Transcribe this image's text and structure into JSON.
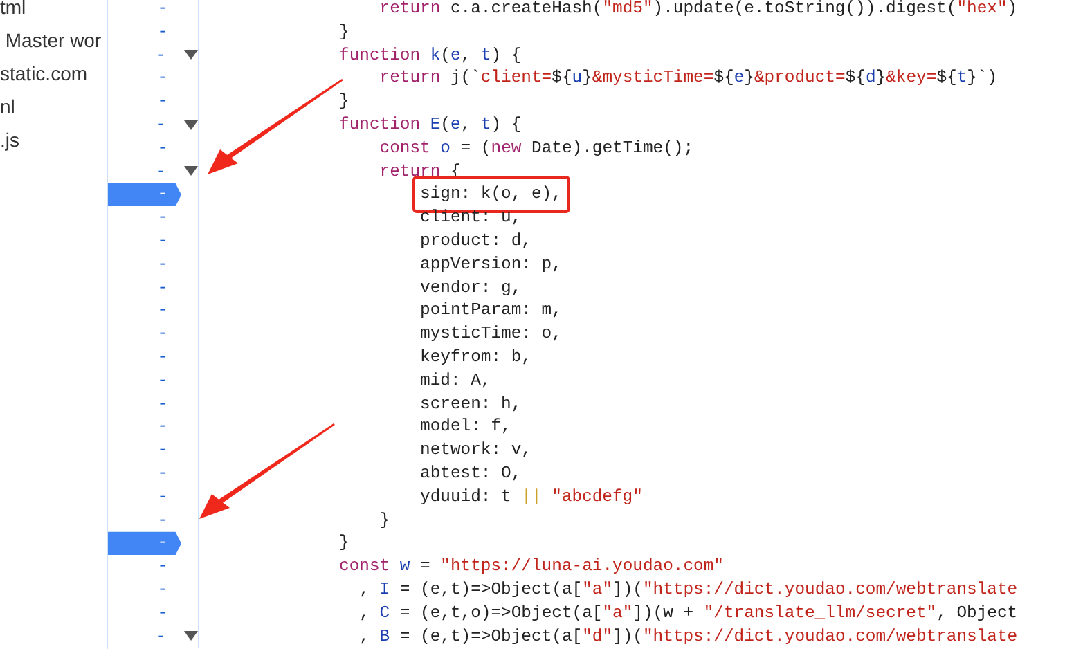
{
  "sidebar": {
    "items": [
      {
        "label": "tml"
      },
      {
        "label": " Master wor"
      },
      {
        "label": "static.com"
      },
      {
        "label": "nl"
      },
      {
        "label": ".js"
      }
    ]
  },
  "editor": {
    "lines": [
      {
        "number": "-",
        "breakpoint": false,
        "foldable": false,
        "boxed": false,
        "tokens": [
          {
            "kind": "keyword",
            "text": "    return"
          },
          {
            "kind": "plain",
            "text": " c.a.createHash("
          },
          {
            "kind": "string",
            "text": "\"md5\""
          },
          {
            "kind": "plain",
            "text": ").update(e.toString()).digest("
          },
          {
            "kind": "string",
            "text": "\"hex\""
          },
          {
            "kind": "plain",
            "text": ")"
          }
        ]
      },
      {
        "number": "-",
        "breakpoint": false,
        "foldable": false,
        "boxed": false,
        "tokens": [
          {
            "kind": "plain",
            "text": "}"
          }
        ]
      },
      {
        "number": "-",
        "breakpoint": false,
        "foldable": true,
        "boxed": false,
        "tokens": [
          {
            "kind": "keyword",
            "text": "function"
          },
          {
            "kind": "name",
            "text": " k"
          },
          {
            "kind": "plain",
            "text": "("
          },
          {
            "kind": "name",
            "text": "e"
          },
          {
            "kind": "plain",
            "text": ", "
          },
          {
            "kind": "name",
            "text": "t"
          },
          {
            "kind": "plain",
            "text": ") {"
          }
        ]
      },
      {
        "number": "-",
        "breakpoint": false,
        "foldable": false,
        "boxed": false,
        "tokens": [
          {
            "kind": "keyword",
            "text": "    return"
          },
          {
            "kind": "plain",
            "text": " j(`"
          },
          {
            "kind": "string",
            "text": "client="
          },
          {
            "kind": "plain",
            "text": "${"
          },
          {
            "kind": "name",
            "text": "u"
          },
          {
            "kind": "plain",
            "text": "}"
          },
          {
            "kind": "string",
            "text": "&mysticTime="
          },
          {
            "kind": "plain",
            "text": "${"
          },
          {
            "kind": "name",
            "text": "e"
          },
          {
            "kind": "plain",
            "text": "}"
          },
          {
            "kind": "string",
            "text": "&product="
          },
          {
            "kind": "plain",
            "text": "${"
          },
          {
            "kind": "name",
            "text": "d"
          },
          {
            "kind": "plain",
            "text": "}"
          },
          {
            "kind": "string",
            "text": "&key="
          },
          {
            "kind": "plain",
            "text": "${"
          },
          {
            "kind": "name",
            "text": "t"
          },
          {
            "kind": "plain",
            "text": "}`)"
          }
        ]
      },
      {
        "number": "-",
        "breakpoint": false,
        "foldable": false,
        "boxed": false,
        "tokens": [
          {
            "kind": "plain",
            "text": "}"
          }
        ]
      },
      {
        "number": "-",
        "breakpoint": false,
        "foldable": true,
        "boxed": false,
        "tokens": [
          {
            "kind": "keyword",
            "text": "function"
          },
          {
            "kind": "name",
            "text": " E"
          },
          {
            "kind": "plain",
            "text": "("
          },
          {
            "kind": "name",
            "text": "e"
          },
          {
            "kind": "plain",
            "text": ", "
          },
          {
            "kind": "name",
            "text": "t"
          },
          {
            "kind": "plain",
            "text": ") {"
          }
        ]
      },
      {
        "number": "-",
        "breakpoint": false,
        "foldable": false,
        "boxed": false,
        "tokens": [
          {
            "kind": "keyword",
            "text": "    const"
          },
          {
            "kind": "name",
            "text": " o"
          },
          {
            "kind": "plain",
            "text": " = ("
          },
          {
            "kind": "keyword",
            "text": "new"
          },
          {
            "kind": "plain",
            "text": " Date).getTime();"
          }
        ]
      },
      {
        "number": "-",
        "breakpoint": false,
        "foldable": true,
        "boxed": false,
        "tokens": [
          {
            "kind": "keyword",
            "text": "    return"
          },
          {
            "kind": "plain",
            "text": " {"
          }
        ]
      },
      {
        "number": "-",
        "breakpoint": true,
        "foldable": false,
        "boxed": true,
        "tokens": [
          {
            "kind": "plain",
            "text": "        sign: k(o, e),"
          }
        ]
      },
      {
        "number": "-",
        "breakpoint": false,
        "foldable": false,
        "boxed": false,
        "tokens": [
          {
            "kind": "plain",
            "text": "        client: u,"
          }
        ]
      },
      {
        "number": "-",
        "breakpoint": false,
        "foldable": false,
        "boxed": false,
        "tokens": [
          {
            "kind": "plain",
            "text": "        product: d,"
          }
        ]
      },
      {
        "number": "-",
        "breakpoint": false,
        "foldable": false,
        "boxed": false,
        "tokens": [
          {
            "kind": "plain",
            "text": "        appVersion: p,"
          }
        ]
      },
      {
        "number": "-",
        "breakpoint": false,
        "foldable": false,
        "boxed": false,
        "tokens": [
          {
            "kind": "plain",
            "text": "        vendor: g,"
          }
        ]
      },
      {
        "number": "-",
        "breakpoint": false,
        "foldable": false,
        "boxed": false,
        "tokens": [
          {
            "kind": "plain",
            "text": "        pointParam: m,"
          }
        ]
      },
      {
        "number": "-",
        "breakpoint": false,
        "foldable": false,
        "boxed": false,
        "tokens": [
          {
            "kind": "plain",
            "text": "        mysticTime: o,"
          }
        ]
      },
      {
        "number": "-",
        "breakpoint": false,
        "foldable": false,
        "boxed": false,
        "tokens": [
          {
            "kind": "plain",
            "text": "        keyfrom: b,"
          }
        ]
      },
      {
        "number": "-",
        "breakpoint": false,
        "foldable": false,
        "boxed": false,
        "tokens": [
          {
            "kind": "plain",
            "text": "        mid: A,"
          }
        ]
      },
      {
        "number": "-",
        "breakpoint": false,
        "foldable": false,
        "boxed": false,
        "tokens": [
          {
            "kind": "plain",
            "text": "        screen: h,"
          }
        ]
      },
      {
        "number": "-",
        "breakpoint": false,
        "foldable": false,
        "boxed": false,
        "tokens": [
          {
            "kind": "plain",
            "text": "        model: f,"
          }
        ]
      },
      {
        "number": "-",
        "breakpoint": false,
        "foldable": false,
        "boxed": false,
        "tokens": [
          {
            "kind": "plain",
            "text": "        network: v,"
          }
        ]
      },
      {
        "number": "-",
        "breakpoint": false,
        "foldable": false,
        "boxed": false,
        "tokens": [
          {
            "kind": "plain",
            "text": "        abtest: O,"
          }
        ]
      },
      {
        "number": "-",
        "breakpoint": false,
        "foldable": false,
        "boxed": false,
        "tokens": [
          {
            "kind": "plain",
            "text": "        yduuid: t "
          },
          {
            "kind": "operator",
            "text": "||"
          },
          {
            "kind": "string",
            "text": " \"abcdefg\""
          }
        ]
      },
      {
        "number": "-",
        "breakpoint": false,
        "foldable": false,
        "boxed": false,
        "tokens": [
          {
            "kind": "plain",
            "text": "    }"
          }
        ]
      },
      {
        "number": "-",
        "breakpoint": true,
        "foldable": false,
        "boxed": false,
        "tokens": [
          {
            "kind": "plain",
            "text": "}"
          }
        ]
      },
      {
        "number": "-",
        "breakpoint": false,
        "foldable": false,
        "boxed": false,
        "tokens": [
          {
            "kind": "keyword",
            "text": "const"
          },
          {
            "kind": "name",
            "text": " w"
          },
          {
            "kind": "plain",
            "text": " = "
          },
          {
            "kind": "string",
            "text": "\"https://luna-ai.youdao.com\""
          }
        ]
      },
      {
        "number": "-",
        "breakpoint": false,
        "foldable": false,
        "boxed": false,
        "tokens": [
          {
            "kind": "plain",
            "text": "  , "
          },
          {
            "kind": "name",
            "text": "I"
          },
          {
            "kind": "plain",
            "text": " = (e,t)=>Object(a["
          },
          {
            "kind": "string",
            "text": "\"a\""
          },
          {
            "kind": "plain",
            "text": "])("
          },
          {
            "kind": "string",
            "text": "\"https://dict.youdao.com/webtranslate"
          }
        ]
      },
      {
        "number": "-",
        "breakpoint": false,
        "foldable": false,
        "boxed": false,
        "tokens": [
          {
            "kind": "plain",
            "text": "  , "
          },
          {
            "kind": "name",
            "text": "C"
          },
          {
            "kind": "plain",
            "text": " = (e,t,o)=>Object(a["
          },
          {
            "kind": "string",
            "text": "\"a\""
          },
          {
            "kind": "plain",
            "text": "])(w + "
          },
          {
            "kind": "string",
            "text": "\"/translate_llm/secret\""
          },
          {
            "kind": "plain",
            "text": ", Object"
          }
        ]
      },
      {
        "number": "-",
        "breakpoint": false,
        "foldable": true,
        "boxed": false,
        "tokens": [
          {
            "kind": "plain",
            "text": "  , "
          },
          {
            "kind": "name",
            "text": "B"
          },
          {
            "kind": "plain",
            "text": " = (e,t)=>Object(a["
          },
          {
            "kind": "string",
            "text": "\"d\""
          },
          {
            "kind": "plain",
            "text": "])("
          },
          {
            "kind": "string",
            "text": "\"https://dict.youdao.com/webtranslate"
          }
        ]
      }
    ]
  },
  "annotations": [
    {
      "kind": "arrow"
    },
    {
      "kind": "arrow"
    }
  ]
}
